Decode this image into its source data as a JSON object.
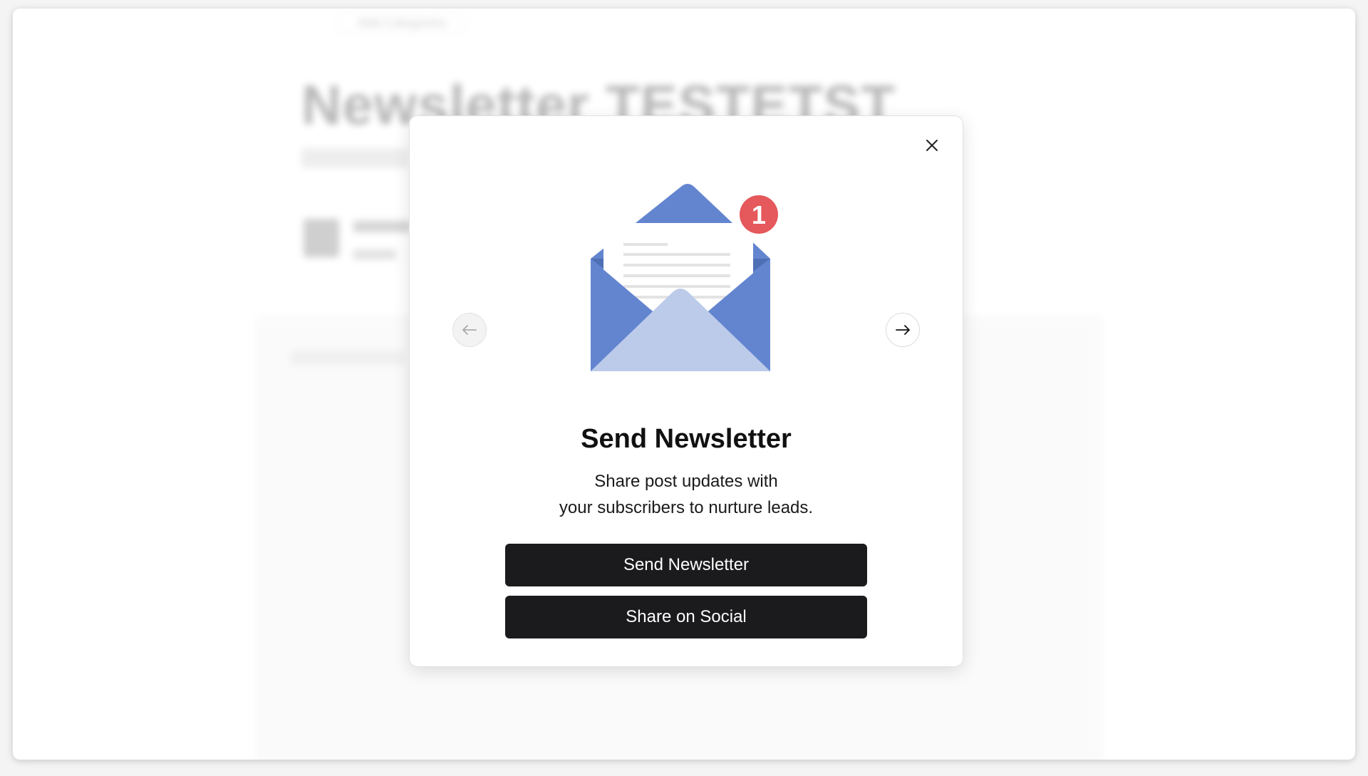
{
  "background": {
    "categories_label": "Add Categories",
    "post_title": "Newsletter TESTETST"
  },
  "modal": {
    "badge_count": "1",
    "title": "Send Newsletter",
    "description_line1": "Share post updates with",
    "description_line2": "your subscribers to nurture leads.",
    "primary_button": "Send Newsletter",
    "secondary_button": "Share on Social"
  },
  "icons": {
    "close": "close-icon",
    "prev": "arrow-left-icon",
    "next": "arrow-right-icon",
    "illustration": "envelope-illustration"
  },
  "colors": {
    "envelope": "#6385d0",
    "envelope_dark": "#4f6fb5",
    "envelope_light": "#bccbea",
    "badge": "#e5585b",
    "button": "#1b1b1d"
  }
}
